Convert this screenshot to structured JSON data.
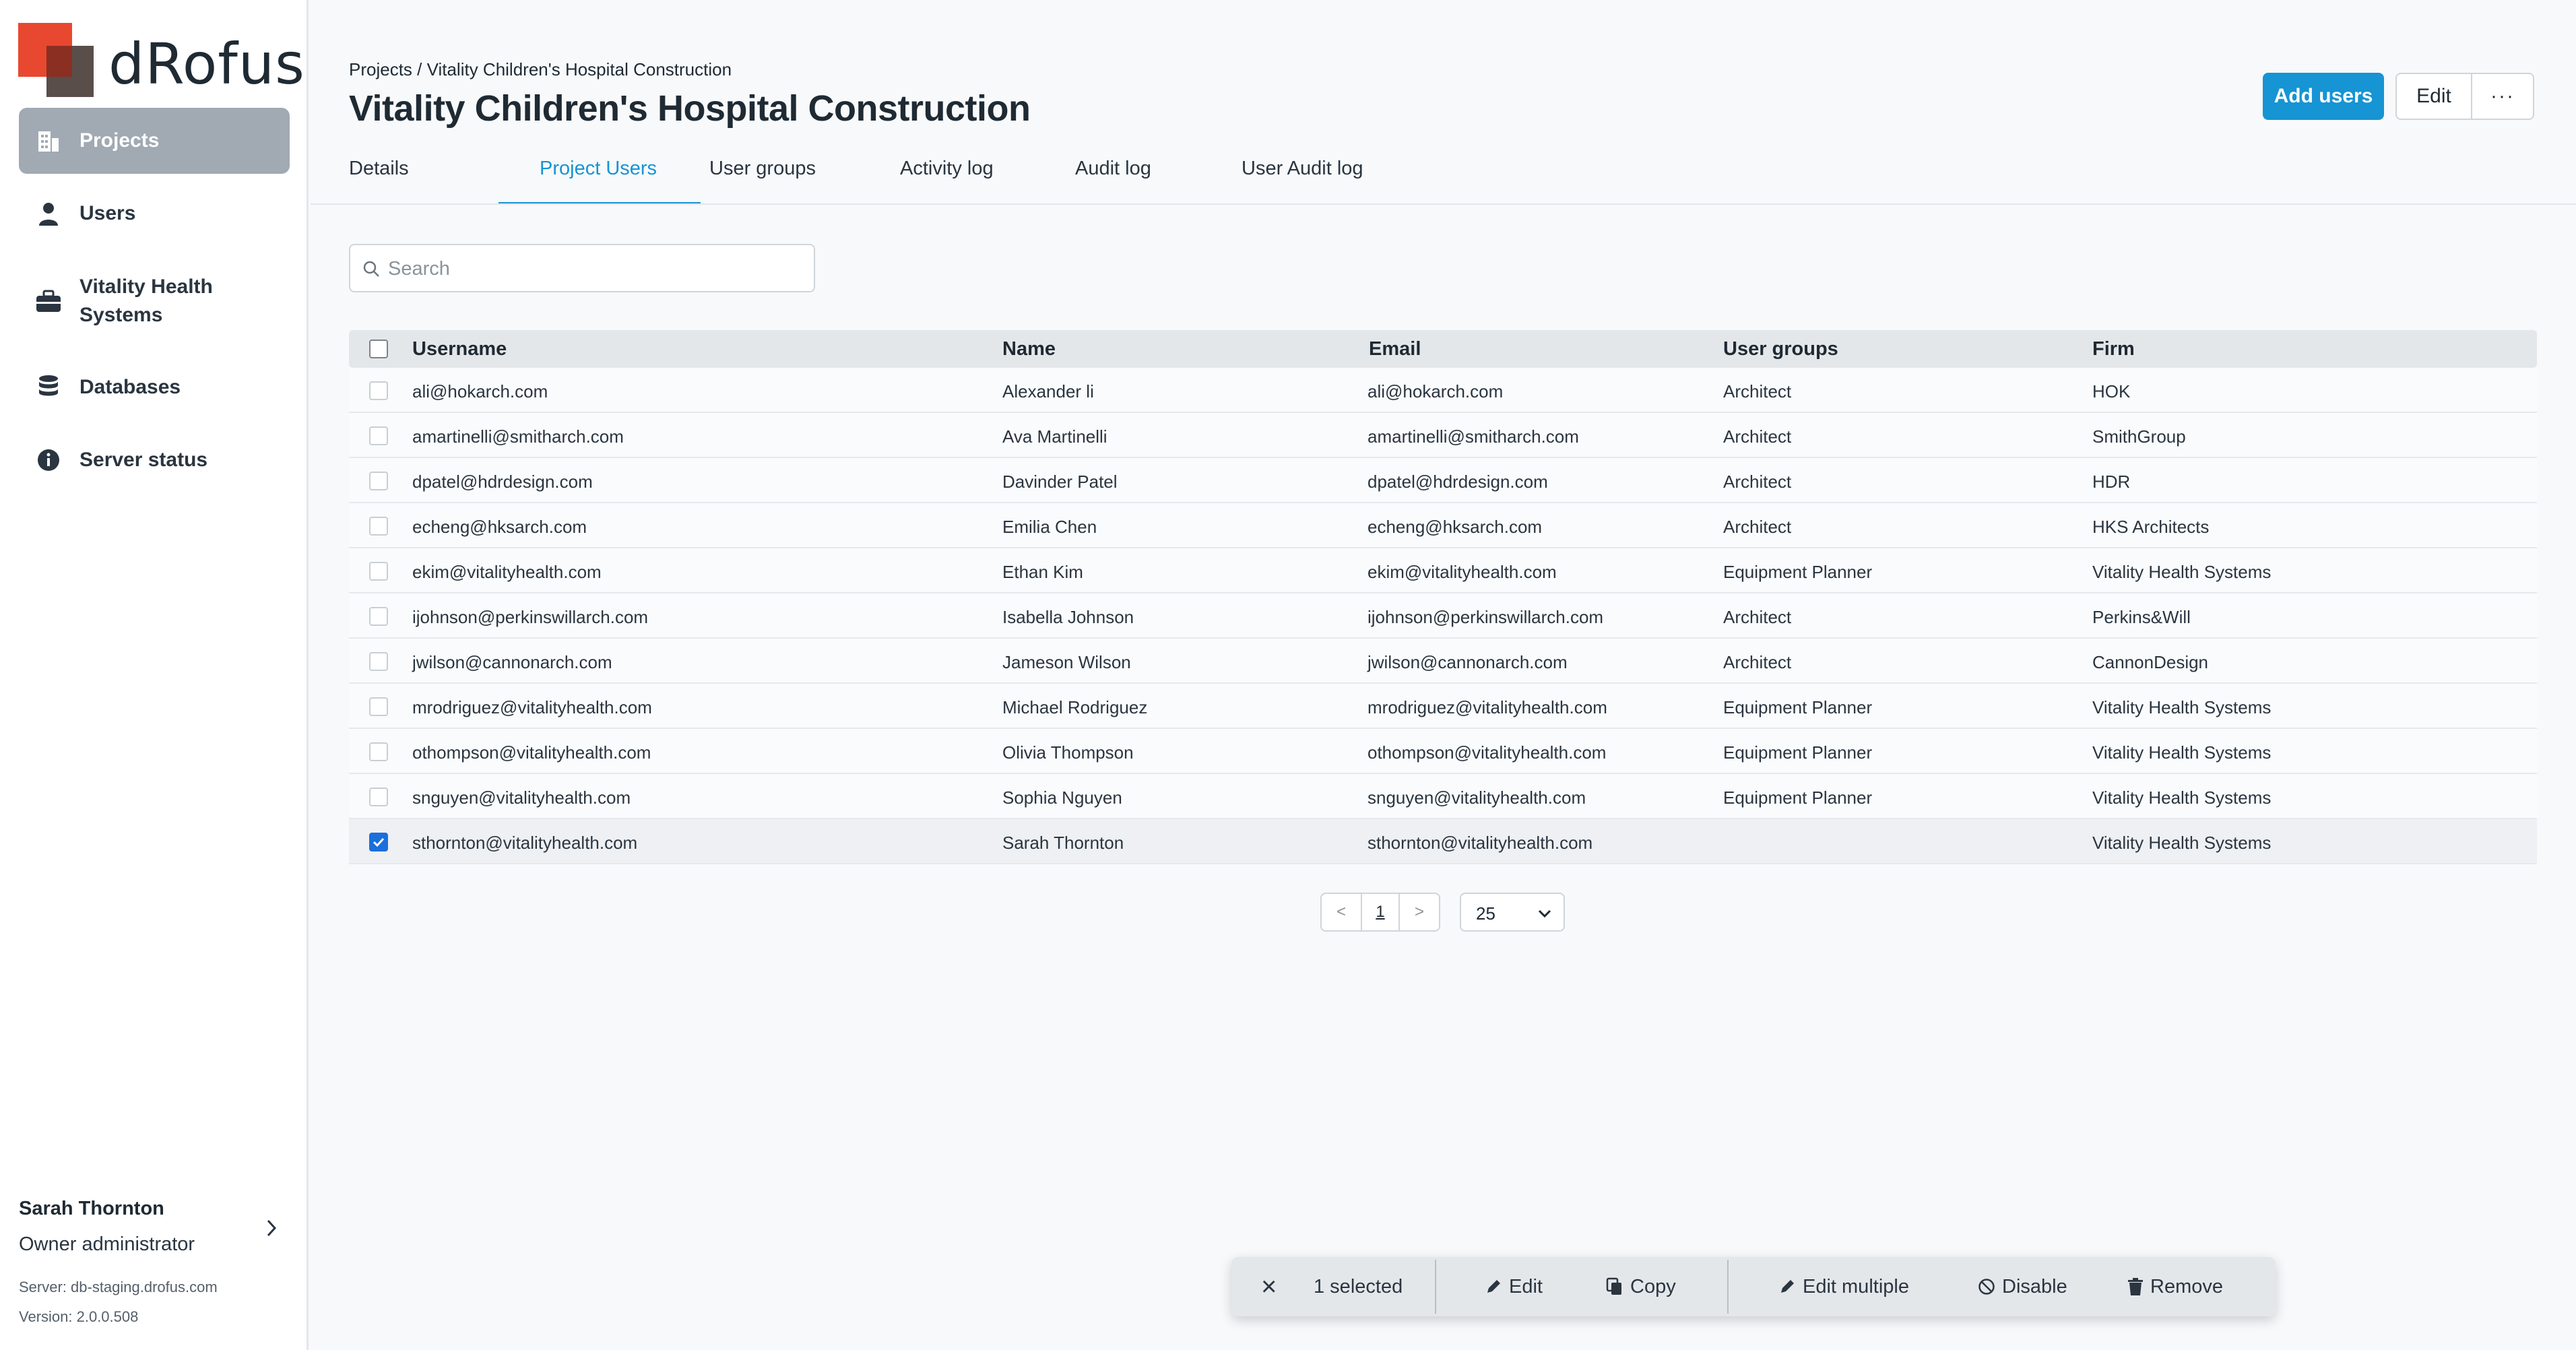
{
  "brand": {
    "name": "dRofus",
    "colors": {
      "primary": "#1694d3",
      "logo_red": "#e8482f",
      "logo_dark": "#3c2f2a"
    }
  },
  "sidebar": {
    "items": [
      {
        "label": "Projects",
        "icon": "building-icon",
        "active": true
      },
      {
        "label": "Users",
        "icon": "user-icon",
        "active": false
      },
      {
        "label": "Vitality Health Systems",
        "icon": "briefcase-icon",
        "active": false
      },
      {
        "label": "Databases",
        "icon": "database-icon",
        "active": false
      },
      {
        "label": "Server status",
        "icon": "info-icon",
        "active": false
      }
    ],
    "footer": {
      "user_name": "Sarah Thornton",
      "role": "Owner administrator",
      "server": "Server: db-staging.drofus.com",
      "version": "Version: 2.0.0.508"
    }
  },
  "header": {
    "breadcrumb": "Projects / Vitality Children's Hospital Construction",
    "title": "Vitality Children's Hospital Construction",
    "add_users_label": "Add users",
    "edit_label": "Edit",
    "more_label": "···"
  },
  "tabs": [
    {
      "label": "Details",
      "active": false
    },
    {
      "label": "Project Users",
      "active": true
    },
    {
      "label": "User groups",
      "active": false
    },
    {
      "label": "Activity log",
      "active": false
    },
    {
      "label": "Audit log",
      "active": false
    },
    {
      "label": "User Audit log",
      "active": false
    }
  ],
  "search": {
    "placeholder": "Search",
    "value": ""
  },
  "table": {
    "columns": [
      "Username",
      "Name",
      "Email",
      "User groups",
      "Firm"
    ],
    "rows": [
      {
        "username": "ali@hokarch.com",
        "name": "Alexander li",
        "email": "ali@hokarch.com",
        "group": "Architect",
        "firm": "HOK",
        "checked": false
      },
      {
        "username": "amartinelli@smitharch.com",
        "name": "Ava Martinelli",
        "email": "amartinelli@smitharch.com",
        "group": "Architect",
        "firm": "SmithGroup",
        "checked": false
      },
      {
        "username": "dpatel@hdrdesign.com",
        "name": "Davinder Patel",
        "email": "dpatel@hdrdesign.com",
        "group": "Architect",
        "firm": "HDR",
        "checked": false
      },
      {
        "username": "echeng@hksarch.com",
        "name": "Emilia Chen",
        "email": "echeng@hksarch.com",
        "group": "Architect",
        "firm": "HKS Architects",
        "checked": false
      },
      {
        "username": "ekim@vitalityhealth.com",
        "name": "Ethan Kim",
        "email": "ekim@vitalityhealth.com",
        "group": "Equipment Planner",
        "firm": "Vitality Health Systems",
        "checked": false
      },
      {
        "username": "ijohnson@perkinswillarch.com",
        "name": "Isabella Johnson",
        "email": "ijohnson@perkinswillarch.com",
        "group": "Architect",
        "firm": "Perkins&Will",
        "checked": false
      },
      {
        "username": "jwilson@cannonarch.com",
        "name": "Jameson Wilson",
        "email": "jwilson@cannonarch.com",
        "group": "Architect",
        "firm": "CannonDesign",
        "checked": false
      },
      {
        "username": "mrodriguez@vitalityhealth.com",
        "name": "Michael Rodriguez",
        "email": "mrodriguez@vitalityhealth.com",
        "group": "Equipment Planner",
        "firm": "Vitality Health Systems",
        "checked": false
      },
      {
        "username": "othompson@vitalityhealth.com",
        "name": "Olivia Thompson",
        "email": "othompson@vitalityhealth.com",
        "group": "Equipment Planner",
        "firm": "Vitality Health Systems",
        "checked": false
      },
      {
        "username": "snguyen@vitalityhealth.com",
        "name": "Sophia Nguyen",
        "email": "snguyen@vitalityhealth.com",
        "group": "Equipment Planner",
        "firm": "Vitality Health Systems",
        "checked": false
      },
      {
        "username": "sthornton@vitalityhealth.com",
        "name": "Sarah Thornton",
        "email": "sthornton@vitalityhealth.com",
        "group": "",
        "firm": "Vitality Health Systems",
        "checked": true
      }
    ]
  },
  "pagination": {
    "prev": "<",
    "current": "1",
    "next": ">",
    "page_size": "25"
  },
  "action_bar": {
    "close_label": "×",
    "selected_text": "1 selected",
    "edit_label": "Edit",
    "copy_label": "Copy",
    "edit_multiple_label": "Edit multiple",
    "disable_label": "Disable",
    "remove_label": "Remove"
  }
}
